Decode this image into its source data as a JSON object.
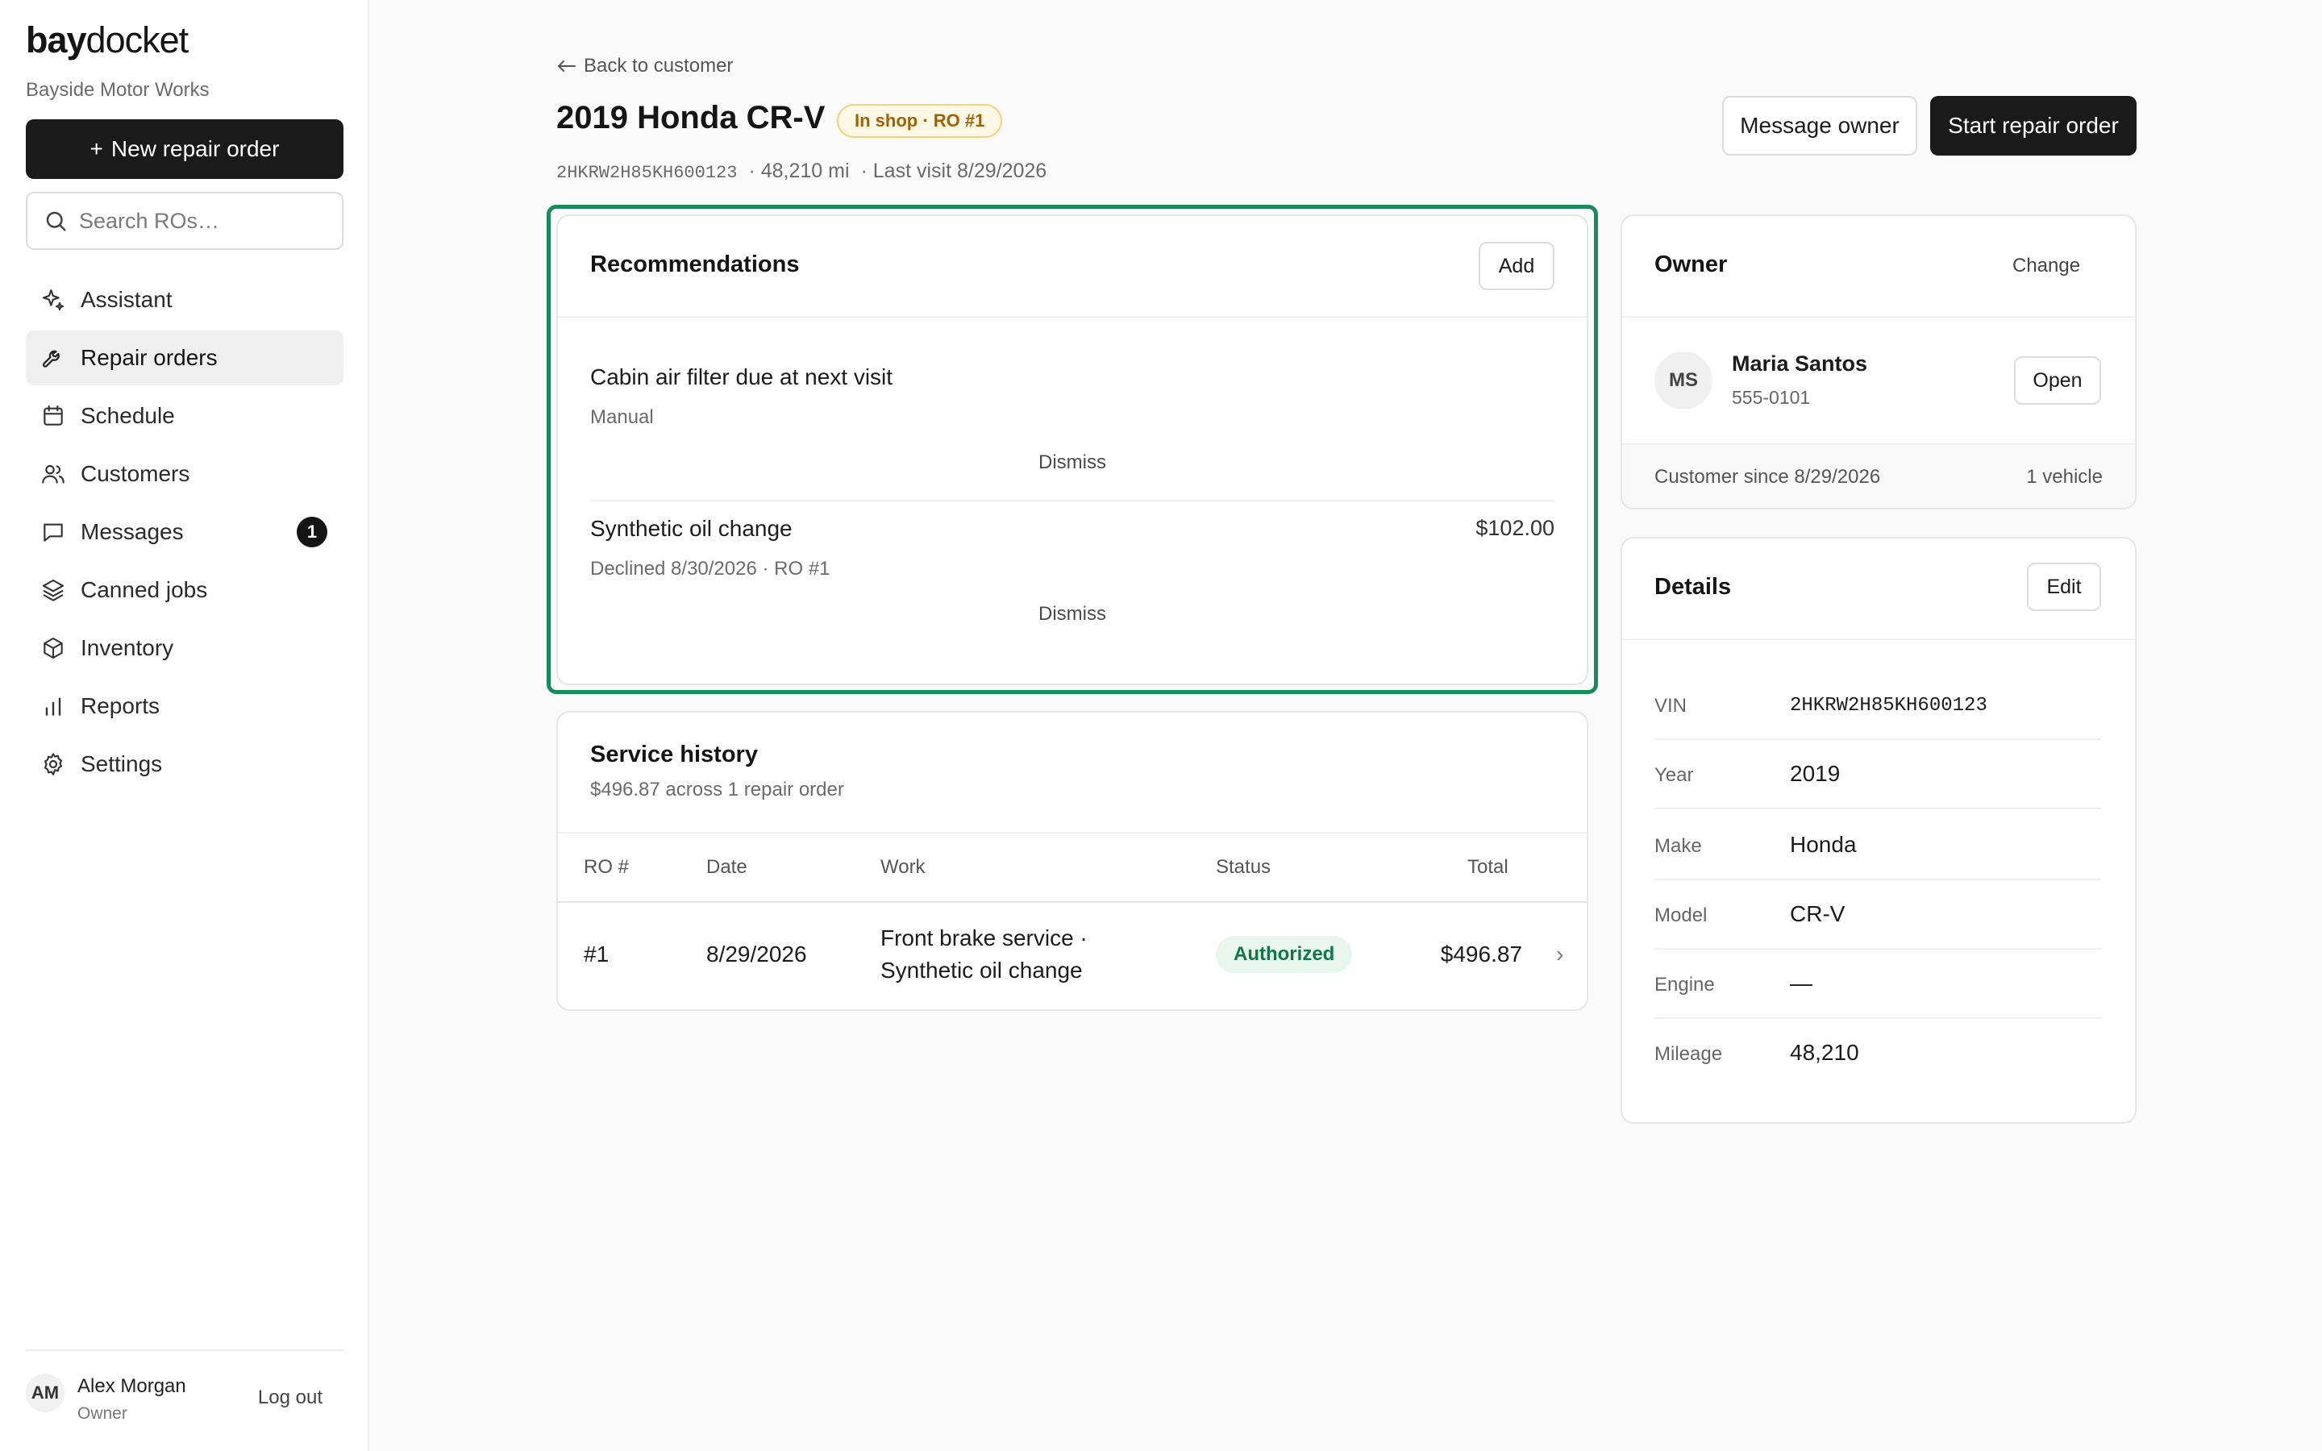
{
  "app": {
    "brand_bold": "bay",
    "brand_rest": "docket",
    "shop_name": "Bayside Motor Works",
    "new_ro_plus": "+",
    "new_ro_label": "New repair order",
    "search_placeholder": "Search ROs…"
  },
  "nav": {
    "items": [
      {
        "label": "Assistant",
        "icon": "sparkle-icon"
      },
      {
        "label": "Repair orders",
        "icon": "wrench-icon",
        "active": true
      },
      {
        "label": "Schedule",
        "icon": "calendar-icon"
      },
      {
        "label": "Customers",
        "icon": "users-icon"
      },
      {
        "label": "Messages",
        "icon": "message-icon",
        "badge": "1"
      },
      {
        "label": "Canned jobs",
        "icon": "layers-icon"
      },
      {
        "label": "Inventory",
        "icon": "box-icon"
      },
      {
        "label": "Reports",
        "icon": "bar-chart-icon"
      },
      {
        "label": "Settings",
        "icon": "gear-icon"
      }
    ]
  },
  "user": {
    "initials": "AM",
    "name": "Alex Morgan",
    "role": "Owner",
    "logout": "Log out"
  },
  "header": {
    "back_label": "Back to customer",
    "title": "2019 Honda CR-V",
    "status": "In shop · RO #1",
    "vin": "2HKRW2H85KH600123",
    "mileage": "· 48,210 mi",
    "last_visit": "· Last visit 8/29/2026",
    "message_owner": "Message owner",
    "start_ro": "Start repair order"
  },
  "recommendations": {
    "title": "Recommendations",
    "add_label": "Add",
    "items": [
      {
        "title": "Cabin air filter due at next visit",
        "sub": "Manual",
        "price": "",
        "dismiss": "Dismiss"
      },
      {
        "title": "Synthetic oil change",
        "sub": "Declined 8/30/2026 · RO #1",
        "price": "$102.00",
        "dismiss": "Dismiss"
      }
    ]
  },
  "service_history": {
    "title": "Service history",
    "subtitle": "$496.87 across 1 repair order",
    "columns": [
      "RO #",
      "Date",
      "Work",
      "Status",
      "Total"
    ],
    "rows": [
      {
        "ro": "#1",
        "date": "8/29/2026",
        "work_line1": "Front brake service ·",
        "work_line2": "Synthetic oil change",
        "status": "Authorized",
        "total": "$496.87",
        "chevron": "›"
      }
    ]
  },
  "owner": {
    "title": "Owner",
    "change_label": "Change",
    "initials": "MS",
    "name": "Maria Santos",
    "phone": "555-0101",
    "open_label": "Open",
    "since": "Customer since 8/29/2026",
    "vehicles": "1 vehicle"
  },
  "details": {
    "title": "Details",
    "edit_label": "Edit",
    "rows": [
      {
        "label": "VIN",
        "value": "2HKRW2H85KH600123"
      },
      {
        "label": "Year",
        "value": "2019"
      },
      {
        "label": "Make",
        "value": "Honda"
      },
      {
        "label": "Model",
        "value": "CR-V"
      },
      {
        "label": "Engine",
        "value": "—"
      },
      {
        "label": "Mileage",
        "value": "48,210"
      }
    ]
  },
  "colors": {
    "accent_dark": "#1a1a1a",
    "highlight_green": "#1a8a5a",
    "status_amber": "#a35f00",
    "status_green": "#11774a"
  }
}
